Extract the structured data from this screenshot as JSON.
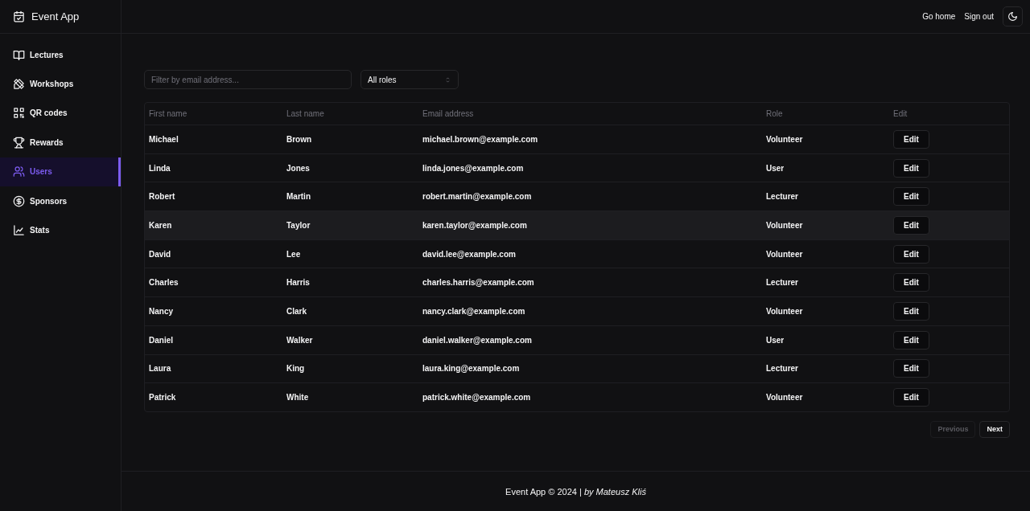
{
  "app": {
    "title": "Event App"
  },
  "sidebar": {
    "items": [
      {
        "label": "Lectures",
        "selected": false
      },
      {
        "label": "Workshops",
        "selected": false
      },
      {
        "label": "QR codes",
        "selected": false
      },
      {
        "label": "Rewards",
        "selected": false
      },
      {
        "label": "Users",
        "selected": true
      },
      {
        "label": "Sponsors",
        "selected": false
      },
      {
        "label": "Stats",
        "selected": false
      }
    ]
  },
  "header": {
    "links": [
      "Go home",
      "Sign out"
    ]
  },
  "filters": {
    "email": {
      "placeholder": "Filter by email address..."
    },
    "role": {
      "value": "All roles"
    }
  },
  "table": {
    "columns": [
      "First name",
      "Last name",
      "Email address",
      "Role",
      "Edit"
    ],
    "rows": [
      {
        "first": "Michael",
        "last": "Brown",
        "email": "michael.brown@example.com",
        "role": "Volunteer",
        "action": "Edit",
        "hovered": false
      },
      {
        "first": "Linda",
        "last": "Jones",
        "email": "linda.jones@example.com",
        "role": "User",
        "action": "Edit",
        "hovered": false
      },
      {
        "first": "Robert",
        "last": "Martin",
        "email": "robert.martin@example.com",
        "role": "Lecturer",
        "action": "Edit",
        "hovered": false
      },
      {
        "first": "Karen",
        "last": "Taylor",
        "email": "karen.taylor@example.com",
        "role": "Volunteer",
        "action": "Edit",
        "hovered": true
      },
      {
        "first": "David",
        "last": "Lee",
        "email": "david.lee@example.com",
        "role": "Volunteer",
        "action": "Edit",
        "hovered": false
      },
      {
        "first": "Charles",
        "last": "Harris",
        "email": "charles.harris@example.com",
        "role": "Lecturer",
        "action": "Edit",
        "hovered": false
      },
      {
        "first": "Nancy",
        "last": "Clark",
        "email": "nancy.clark@example.com",
        "role": "Volunteer",
        "action": "Edit",
        "hovered": false
      },
      {
        "first": "Daniel",
        "last": "Walker",
        "email": "daniel.walker@example.com",
        "role": "User",
        "action": "Edit",
        "hovered": false
      },
      {
        "first": "Laura",
        "last": "King",
        "email": "laura.king@example.com",
        "role": "Lecturer",
        "action": "Edit",
        "hovered": false
      },
      {
        "first": "Patrick",
        "last": "White",
        "email": "patrick.white@example.com",
        "role": "Volunteer",
        "action": "Edit",
        "hovered": false
      }
    ]
  },
  "pagination": [
    {
      "label": "Previous",
      "disabled": true
    },
    {
      "label": "Next",
      "disabled": false
    }
  ],
  "footer": "Event App © 2024 | *by Mateusz Kliś*"
}
